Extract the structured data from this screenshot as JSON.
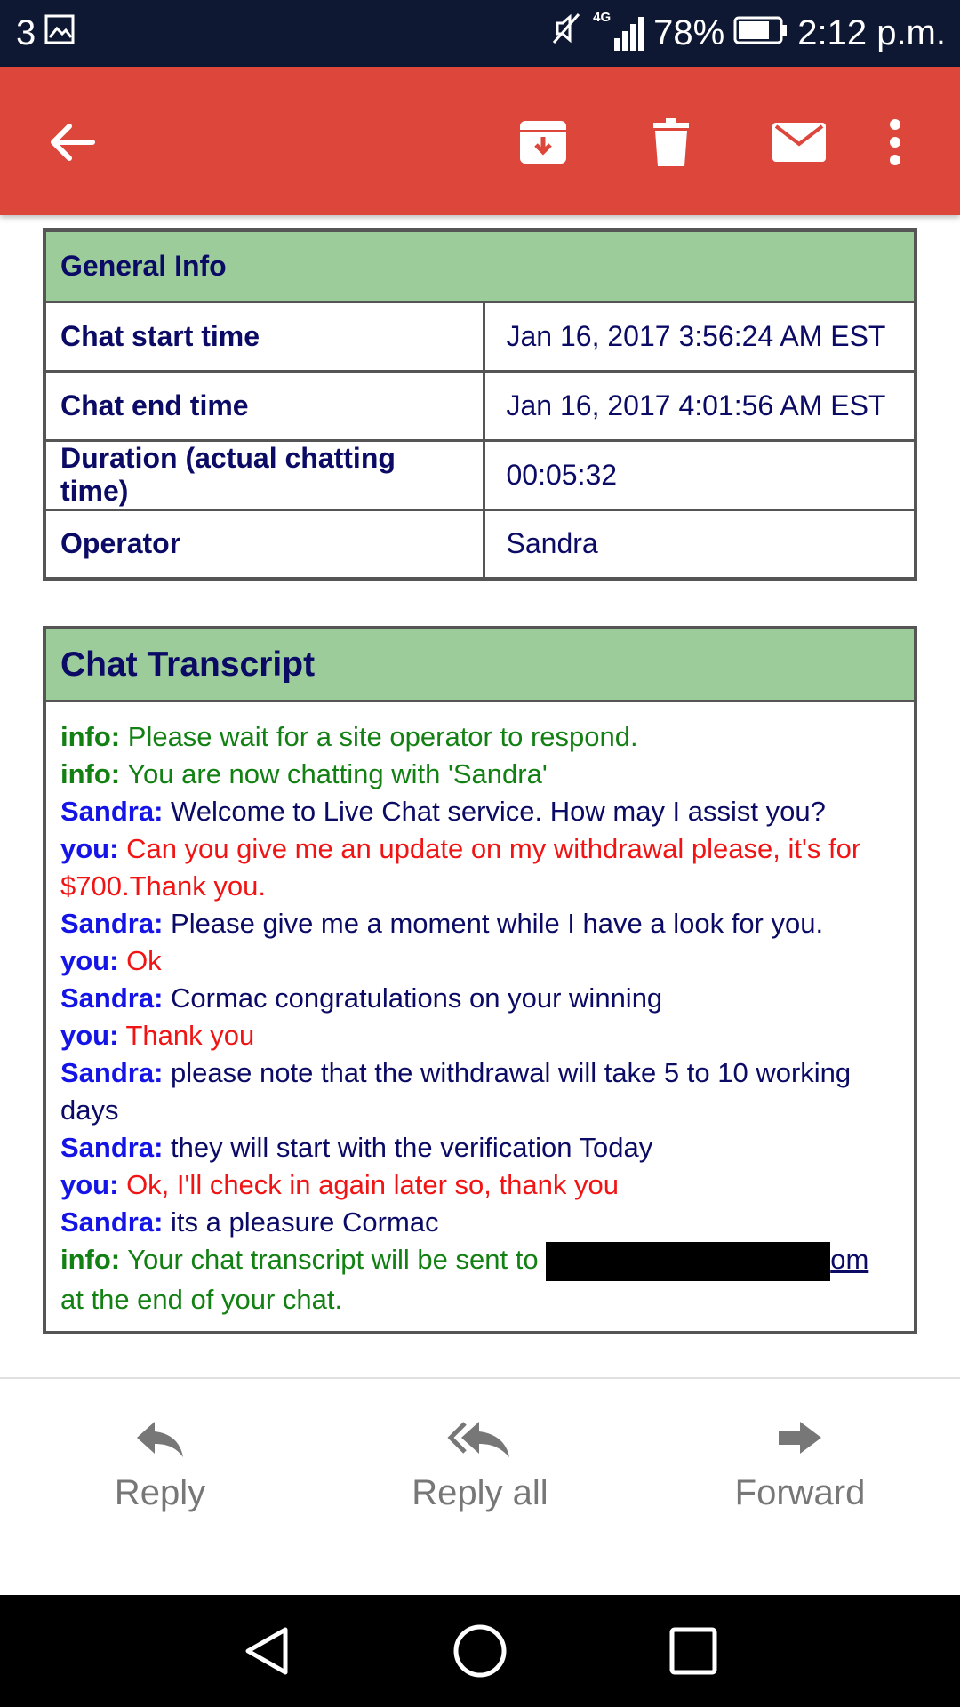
{
  "status_bar": {
    "notification_count": "3",
    "network": "4G",
    "battery": "78%",
    "time": "2:12 p.m."
  },
  "app_bar": {
    "icons": [
      "back-arrow-icon",
      "archive-icon",
      "delete-icon",
      "mail-icon",
      "more-vert-icon"
    ]
  },
  "general_info": {
    "title": "General Info",
    "rows": [
      {
        "label": "Chat start time",
        "value": "Jan 16, 2017 3:56:24 AM EST"
      },
      {
        "label": "Chat end time",
        "value": "Jan 16, 2017 4:01:56 AM EST"
      },
      {
        "label": "Duration (actual chatting time)",
        "value": "00:05:32"
      },
      {
        "label": "Operator",
        "value": "Sandra"
      }
    ]
  },
  "transcript": {
    "title": "Chat Transcript",
    "messages": [
      {
        "speaker": "info:",
        "text": "Please wait for a site operator to respond."
      },
      {
        "speaker": "info:",
        "text": "You are now chatting with 'Sandra'"
      },
      {
        "speaker": "Sandra:",
        "text": "Welcome to Live Chat service. How may I assist you?"
      },
      {
        "speaker": "you:",
        "text": "Can you give me an update on my withdrawal please, it's for $700.Thank you."
      },
      {
        "speaker": "Sandra:",
        "text": "Please give me a moment while I have a look for you."
      },
      {
        "speaker": "you:",
        "text": "Ok"
      },
      {
        "speaker": "Sandra:",
        "text": "Cormac congratulations on your winning"
      },
      {
        "speaker": "you:",
        "text": "Thank you"
      },
      {
        "speaker": "Sandra:",
        "text": "please note that the withdrawal will take 5 to 10 working days"
      },
      {
        "speaker": "Sandra:",
        "text": "they will start with the verification Today"
      },
      {
        "speaker": "you:",
        "text": "Ok, I'll check in again later so, thank you"
      },
      {
        "speaker": "Sandra:",
        "text": "its a pleasure Cormac"
      }
    ],
    "final": {
      "speaker": "info:",
      "text_before": "Your chat transcript will be sent to",
      "email_tail": "om",
      "text_after": "at the end of your chat."
    }
  },
  "actions": {
    "reply": "Reply",
    "reply_all": "Reply all",
    "forward": "Forward"
  },
  "colors": {
    "app_bar": "#dc463b",
    "status_bar": "#0f1833",
    "table_header": "#9ccc9a",
    "info_text": "#128012",
    "operator_name": "#1414e6",
    "user_text": "#f01414"
  }
}
